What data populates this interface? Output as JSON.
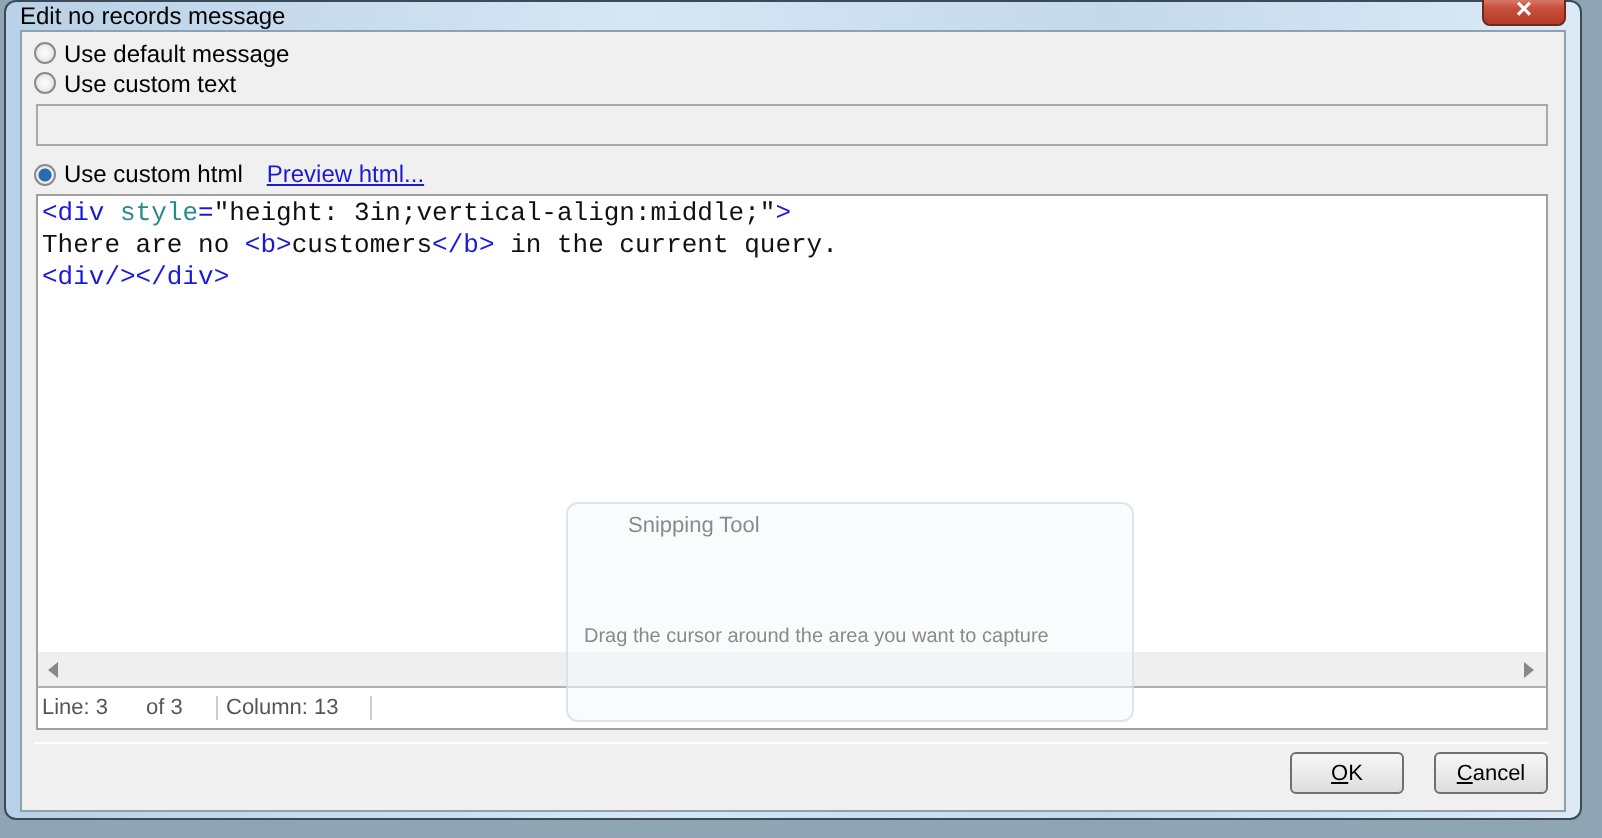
{
  "window": {
    "title": "Edit no records message",
    "close": "×"
  },
  "options": [
    {
      "label": "Use default message",
      "selected": false
    },
    {
      "label": "Use custom text",
      "selected": false
    },
    {
      "label": "Use custom html",
      "selected": true
    }
  ],
  "preview_link": "Preview html...",
  "editor": {
    "lines": [
      [
        {
          "kind": "tag",
          "text": "<div "
        },
        {
          "kind": "attr",
          "text": "style"
        },
        {
          "kind": "tag",
          "text": "="
        },
        {
          "kind": "text",
          "text": "\"height: 3in;vertical-align:middle;\""
        },
        {
          "kind": "tag",
          "text": ">"
        }
      ],
      [
        {
          "kind": "text",
          "text": "There are no "
        },
        {
          "kind": "tag",
          "text": "<b>"
        },
        {
          "kind": "text",
          "text": "customers"
        },
        {
          "kind": "tag",
          "text": "</b>"
        },
        {
          "kind": "text",
          "text": " in the current query."
        }
      ],
      [
        {
          "kind": "tag",
          "text": "<div/></div>"
        }
      ]
    ]
  },
  "status_bar": {
    "line": "Line: 3",
    "of": "of 3",
    "column": "Column: 13"
  },
  "overlay": {
    "title": "Snipping Tool",
    "hint": "Drag the cursor around the area you want to capture"
  },
  "buttons": [
    {
      "label": "OK"
    },
    {
      "label": "Cancel"
    }
  ]
}
